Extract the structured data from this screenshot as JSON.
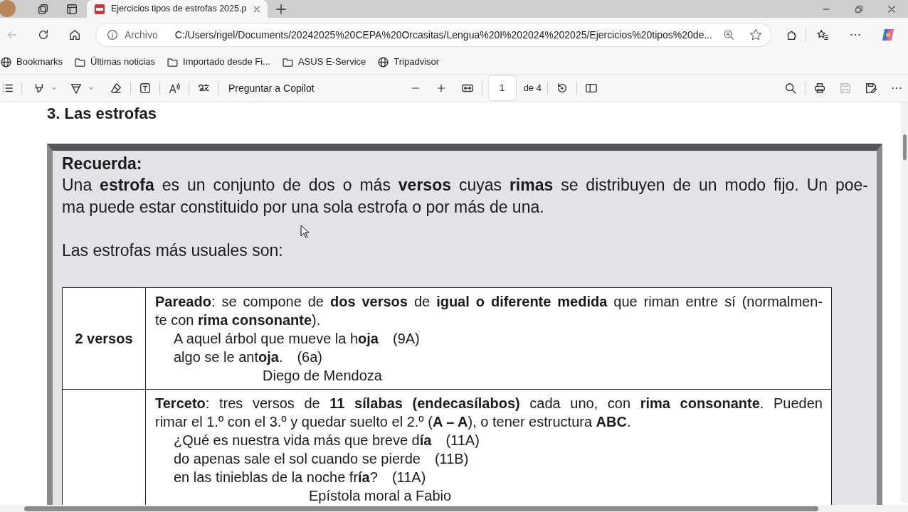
{
  "browser": {
    "tabs": [
      {
        "title": "Ejercicios tipos de estrofas 2025.p",
        "selected": true
      }
    ],
    "address": {
      "scheme": "Archivo",
      "url": "C:/Users/rigel/Documents/20242025%20CEPA%20Orcasitas/Lengua%20I%202024%202025/Ejercicios%20tipos%20de..."
    },
    "bookmarks": [
      {
        "label": "Bookmarks",
        "kind": "globe"
      },
      {
        "label": "Últimas noticias",
        "kind": "folder"
      },
      {
        "label": "Importado desde Fi...",
        "kind": "folder"
      },
      {
        "label": "ASUS E-Service",
        "kind": "folder"
      },
      {
        "label": "Tripadvisor",
        "kind": "globe"
      }
    ]
  },
  "pdf_toolbar": {
    "copilot": "Preguntar a Copilot",
    "page": "1",
    "page_count": "de 4"
  },
  "document": {
    "heading": "3. Las estrofas",
    "box": {
      "title": "Recuerda:",
      "paragraph": [
        "Una **estrofa** es un conjunto de dos o más **versos** cuyas **rimas** se distribuyen de un modo fijo. Un poe-",
        "ma puede estar constituido por una sola estrofa o por más de una."
      ],
      "intro": "Las estrofas más usuales son:"
    },
    "rows": [
      {
        "label": "2 versos",
        "definition": [
          "**Pareado**: se compone de **dos versos** de **igual o diferente medida** que riman entre sí (normalmen-",
          "te con **rima consonante**)."
        ],
        "verses": [
          {
            "text": "A aquel árbol que mueve la h**oja**",
            "rhyme": "(9A)"
          },
          {
            "text": "algo se le ant**oja**.",
            "rhyme": "(6a)"
          }
        ],
        "source": "Diego de Mendoza"
      },
      {
        "definition": [
          "**Terceto**: tres versos de **11 sílabas (endecasílabos)** cada uno, con **rima consonante**. Pueden",
          "rimar el 1.º con el 3.º y quedar suelto el 2.º (**A – A**), o tener estructura **ABC**."
        ],
        "verses": [
          {
            "text": "¿Qué es nuestra vida más que breve d**ía**",
            "rhyme": "(11A)"
          },
          {
            "text": "do apenas sale el sol cuando se pierde",
            "rhyme": "(11B)"
          },
          {
            "text": "en las tinieblas de la noche fr**ía**?",
            "rhyme": "(11A)"
          }
        ],
        "source": "Epístola moral a Fabio"
      }
    ]
  }
}
